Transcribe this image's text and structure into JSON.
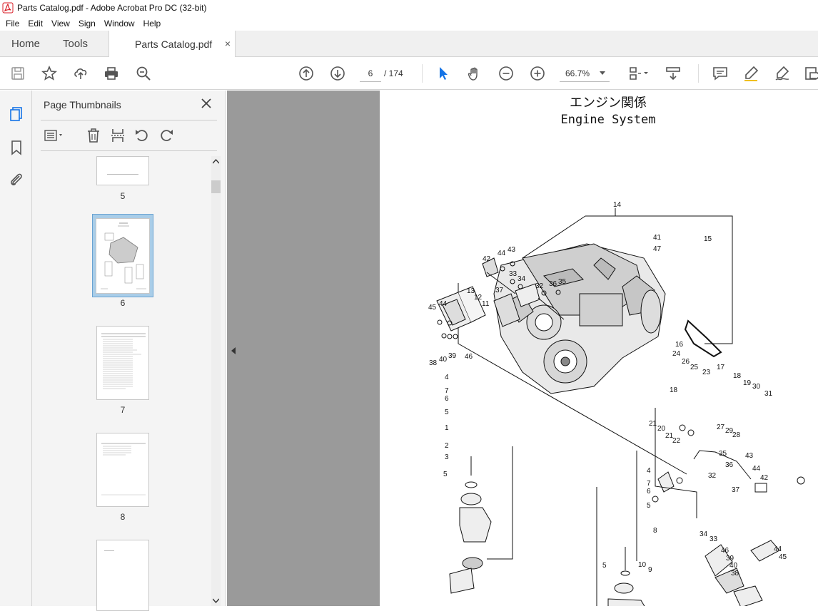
{
  "window": {
    "title": "Parts Catalog.pdf - Adobe Acrobat Pro DC (32-bit)",
    "icon": "acrobat-pdf-icon",
    "accent_color": "#d81b24"
  },
  "menu": [
    "File",
    "Edit",
    "View",
    "Sign",
    "Window",
    "Help"
  ],
  "tabs": {
    "home": "Home",
    "tools": "Tools",
    "document": "Parts Catalog.pdf",
    "close": "×"
  },
  "toolbar": {
    "current_page": "6",
    "page_total": "/ 174",
    "zoom": "66.7%",
    "icons": [
      "save-icon",
      "bookmark-star-icon",
      "upload-icon",
      "print-icon",
      "search-zoom-icon",
      "page-up-icon",
      "page-down-icon",
      "select-arrow-icon",
      "hand-icon",
      "zoom-out-icon",
      "zoom-in-icon",
      "page-fit-icon",
      "scroll-mode-icon",
      "comment-icon",
      "highlight-pen-icon",
      "sign-icon",
      "more-tools-icon"
    ]
  },
  "thumbnails_panel": {
    "title": "Page Thumbnails",
    "pages": [
      {
        "number": "5"
      },
      {
        "number": "6",
        "selected": true
      },
      {
        "number": "7"
      },
      {
        "number": "8"
      }
    ]
  },
  "document": {
    "title_jp": "エンジン関係",
    "title_en": "Engine System",
    "callouts": {
      "top_bracket": [
        "42",
        "44",
        "43",
        "33",
        "34",
        "37",
        "32",
        "36",
        "35",
        "45",
        "44",
        "38",
        "40",
        "39",
        "46"
      ],
      "engine": [
        "14",
        "15",
        "41",
        "47",
        "13",
        "12",
        "11",
        "16"
      ],
      "left_mount": [
        "4",
        "7",
        "6",
        "5",
        "1",
        "2",
        "3",
        "5"
      ],
      "right_pipe": [
        "24",
        "26",
        "25",
        "17",
        "23",
        "18",
        "19",
        "30",
        "31",
        "18",
        "27",
        "29",
        "28",
        "21",
        "20",
        "21",
        "22"
      ],
      "center_mount": [
        "4",
        "7",
        "6",
        "5",
        "8",
        "5",
        "10",
        "9"
      ],
      "right_bracket": [
        "35",
        "36",
        "32",
        "43",
        "44",
        "42",
        "37",
        "34",
        "33",
        "46",
        "39",
        "40",
        "38",
        "44",
        "45"
      ]
    }
  }
}
